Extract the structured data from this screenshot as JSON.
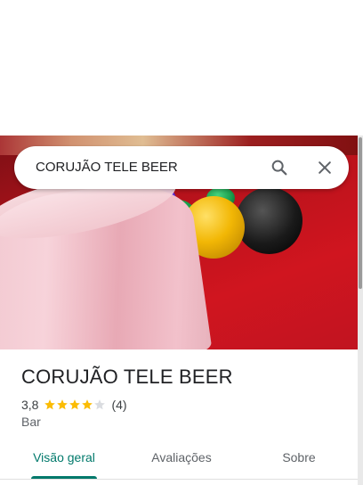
{
  "search": {
    "value": "CORUJÃO TELE BEER"
  },
  "place": {
    "name": "CORUJÃO TELE BEER",
    "rating": "3,8",
    "rating_value": 3.8,
    "stars_filled": 4,
    "review_count": "(4)",
    "category": "Bar"
  },
  "tabs": [
    {
      "label": "Visão geral",
      "active": true
    },
    {
      "label": "Avaliações",
      "active": false
    },
    {
      "label": "Sobre",
      "active": false
    }
  ],
  "colors": {
    "accent": "#00796b",
    "star": "#fbbc04",
    "star_empty": "#dadce0"
  },
  "icons": {
    "search": "search-icon",
    "close": "close-icon"
  }
}
